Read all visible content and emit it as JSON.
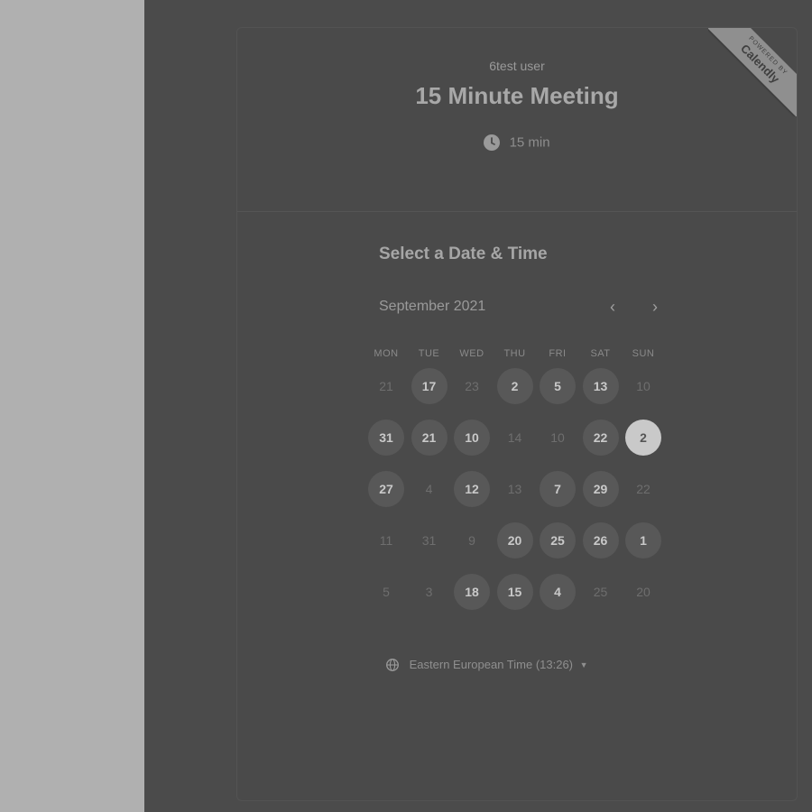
{
  "event": {
    "host": "6test user",
    "title": "15 Minute Meeting",
    "duration": "15 min"
  },
  "badge": {
    "powered_by": "POWERED BY",
    "brand": "Calendly"
  },
  "calendar": {
    "section_title": "Select a Date & Time",
    "month": "September 2021",
    "prev_icon": "chevron-left-icon",
    "next_icon": "chevron-right-icon",
    "weekdays": [
      "MON",
      "TUE",
      "WED",
      "THU",
      "FRI",
      "SAT",
      "SUN"
    ],
    "weeks": [
      [
        {
          "d": "21",
          "s": "off"
        },
        {
          "d": "17",
          "s": "on"
        },
        {
          "d": "23",
          "s": "off"
        },
        {
          "d": "2",
          "s": "on"
        },
        {
          "d": "5",
          "s": "on"
        },
        {
          "d": "13",
          "s": "on"
        },
        {
          "d": "10",
          "s": "off"
        }
      ],
      [
        {
          "d": "31",
          "s": "on"
        },
        {
          "d": "21",
          "s": "on"
        },
        {
          "d": "10",
          "s": "on"
        },
        {
          "d": "14",
          "s": "off"
        },
        {
          "d": "10",
          "s": "off"
        },
        {
          "d": "22",
          "s": "on"
        },
        {
          "d": "2",
          "s": "sel"
        }
      ],
      [
        {
          "d": "27",
          "s": "on"
        },
        {
          "d": "4",
          "s": "off"
        },
        {
          "d": "12",
          "s": "on"
        },
        {
          "d": "13",
          "s": "off"
        },
        {
          "d": "7",
          "s": "on"
        },
        {
          "d": "29",
          "s": "on"
        },
        {
          "d": "22",
          "s": "off"
        }
      ],
      [
        {
          "d": "11",
          "s": "off"
        },
        {
          "d": "31",
          "s": "off"
        },
        {
          "d": "9",
          "s": "off"
        },
        {
          "d": "20",
          "s": "on"
        },
        {
          "d": "25",
          "s": "on"
        },
        {
          "d": "26",
          "s": "on"
        },
        {
          "d": "1",
          "s": "on"
        }
      ],
      [
        {
          "d": "5",
          "s": "off"
        },
        {
          "d": "3",
          "s": "off"
        },
        {
          "d": "18",
          "s": "on"
        },
        {
          "d": "15",
          "s": "on"
        },
        {
          "d": "4",
          "s": "on"
        },
        {
          "d": "25",
          "s": "off"
        },
        {
          "d": "20",
          "s": "off"
        }
      ]
    ]
  },
  "timezone": {
    "label": "Eastern European Time (13:26)",
    "icon": "globe-icon"
  },
  "colors": {
    "overlay": "#4b4b4b",
    "side_panel": "#b0b0b0",
    "available_day": "#585858",
    "selected_day": "#c9c9c9"
  }
}
